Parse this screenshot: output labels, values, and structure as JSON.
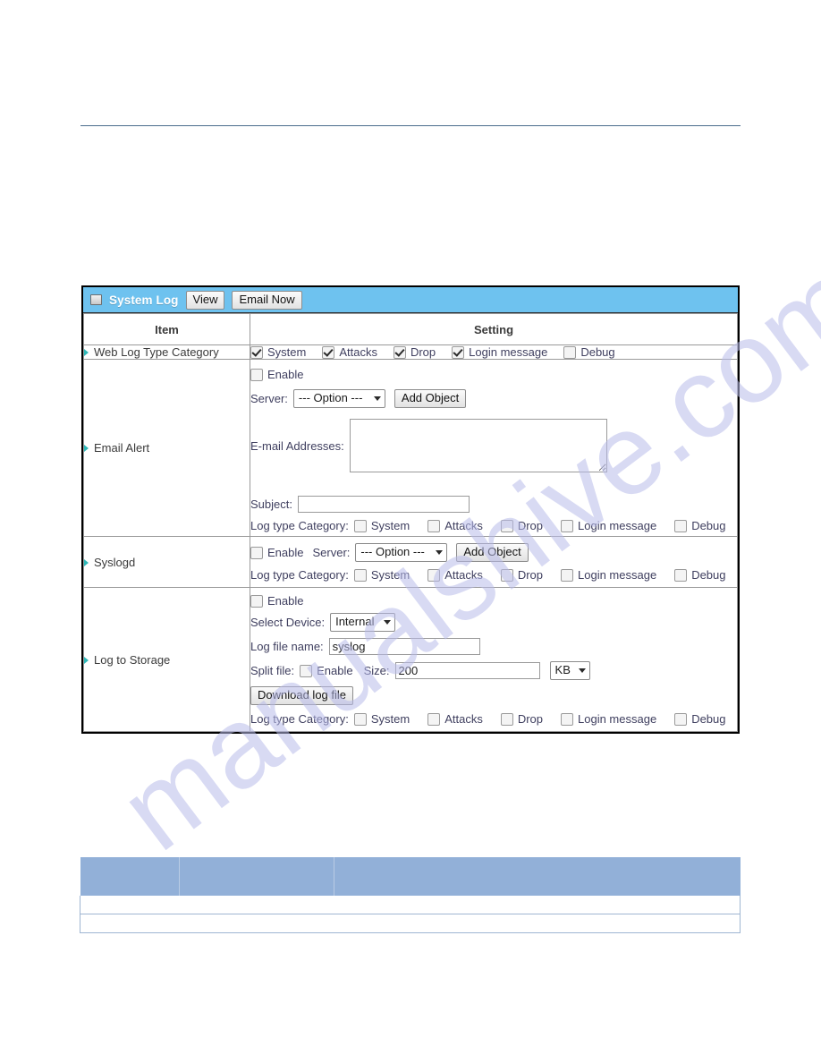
{
  "watermark": {
    "text": "manualshive.com"
  },
  "panel": {
    "icon": "window-box-icon",
    "title": "System Log",
    "buttons": {
      "view": "View",
      "email_now": "Email Now"
    },
    "accent_color": "#6ec2ef"
  },
  "table": {
    "headers": {
      "item": "Item",
      "setting": "Setting"
    },
    "rows": {
      "web_log": {
        "item_label": "Web Log Type Category",
        "checkboxes": [
          {
            "label": "System",
            "checked": true
          },
          {
            "label": "Attacks",
            "checked": true
          },
          {
            "label": "Drop",
            "checked": true
          },
          {
            "label": "Login message",
            "checked": true
          },
          {
            "label": "Debug",
            "checked": false
          }
        ]
      },
      "email_alert": {
        "item_label": "Email Alert",
        "enable_label": "Enable",
        "enable_checked": false,
        "server_label": "Server:",
        "server_value": "--- Option ---",
        "add_object_label": "Add Object",
        "email_addresses_label": "E-mail Addresses:",
        "email_addresses_value": "",
        "subject_label": "Subject:",
        "subject_value": "",
        "log_type_label": "Log type Category:",
        "log_type_checkboxes": [
          {
            "label": "System",
            "checked": false
          },
          {
            "label": "Attacks",
            "checked": false
          },
          {
            "label": "Drop",
            "checked": false
          },
          {
            "label": "Login message",
            "checked": false
          },
          {
            "label": "Debug",
            "checked": false
          }
        ]
      },
      "syslogd": {
        "item_label": "Syslogd",
        "enable_label": "Enable",
        "enable_checked": false,
        "server_label": "Server:",
        "server_value": "--- Option ---",
        "add_object_label": "Add Object",
        "log_type_label": "Log type Category:",
        "log_type_checkboxes": [
          {
            "label": "System",
            "checked": false
          },
          {
            "label": "Attacks",
            "checked": false
          },
          {
            "label": "Drop",
            "checked": false
          },
          {
            "label": "Login message",
            "checked": false
          },
          {
            "label": "Debug",
            "checked": false
          }
        ]
      },
      "log_to_storage": {
        "item_label": "Log to Storage",
        "enable_label": "Enable",
        "enable_checked": false,
        "select_device_label": "Select Device:",
        "select_device_value": "Internal",
        "log_file_name_label": "Log file name:",
        "log_file_name_value": "syslog",
        "split_file_label": "Split file:",
        "split_enable_label": "Enable",
        "split_enable_checked": false,
        "size_label": "Size:",
        "size_value": "200",
        "size_unit": "KB",
        "download_label": "Download log file",
        "log_type_label": "Log type Category:",
        "log_type_checkboxes": [
          {
            "label": "System",
            "checked": false
          },
          {
            "label": "Attacks",
            "checked": false
          },
          {
            "label": "Drop",
            "checked": false
          },
          {
            "label": "Login message",
            "checked": false
          },
          {
            "label": "Debug",
            "checked": false
          }
        ]
      }
    }
  },
  "bottom_table": {
    "header_color": "#92b0d8",
    "columns": [
      "",
      "",
      ""
    ],
    "rows": [
      [
        "",
        "",
        ""
      ],
      [
        "",
        "",
        ""
      ]
    ]
  }
}
